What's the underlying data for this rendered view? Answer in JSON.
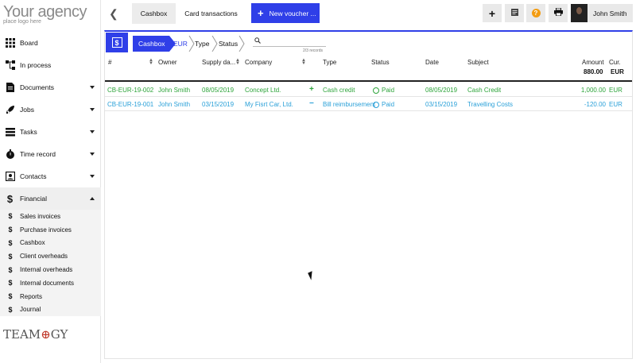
{
  "logo": {
    "title": "Your agency",
    "subtitle": "place logo here"
  },
  "sidebar": {
    "items": [
      {
        "label": "Board",
        "icon": "grid-icon"
      },
      {
        "label": "In process",
        "icon": "process-icon"
      },
      {
        "label": "Documents",
        "icon": "document-icon"
      },
      {
        "label": "Jobs",
        "icon": "rocket-icon"
      },
      {
        "label": "Tasks",
        "icon": "tasks-icon"
      },
      {
        "label": "Time record",
        "icon": "stopwatch-icon"
      },
      {
        "label": "Contacts",
        "icon": "contacts-icon"
      },
      {
        "label": "Financial",
        "icon": "dollar-icon"
      }
    ],
    "financial_sub": [
      {
        "label": "Sales invoices"
      },
      {
        "label": "Purchase invoices"
      },
      {
        "label": "Cashbox"
      },
      {
        "label": "Client overheads"
      },
      {
        "label": "Internal overheads"
      },
      {
        "label": "Internal documents"
      },
      {
        "label": "Reports"
      },
      {
        "label": "Journal"
      }
    ],
    "footer_logo": "TEAMOGY"
  },
  "topbar": {
    "tabs": [
      {
        "label": "Cashbox"
      },
      {
        "label": "Card transactions"
      }
    ],
    "new_button": "New voucher ...",
    "user_name": "John Smith"
  },
  "breadcrumbs": {
    "items": [
      "Cashbox",
      "EUR",
      "Type",
      "Status"
    ],
    "records": "2/3 records"
  },
  "table": {
    "columns": {
      "num": "#",
      "owner": "Owner",
      "supply_date": "Supply da...",
      "company": "Company",
      "type": "Type",
      "status": "Status",
      "date": "Date",
      "subject": "Subject",
      "amount": "Amount",
      "cur": "Cur."
    },
    "totals": {
      "amount": "880.00",
      "cur": "EUR"
    },
    "rows": [
      {
        "num": "CB-EUR-19-002",
        "owner": "John Smith",
        "supply_date": "08/05/2019",
        "company": "Concept Ltd.",
        "sign": "+",
        "type": "Cash credit",
        "status": "Paid",
        "date": "08/05/2019",
        "subject": "Cash Credit",
        "amount": "1,000.00",
        "cur": "EUR"
      },
      {
        "num": "CB-EUR-19-001",
        "owner": "John Smith",
        "supply_date": "03/15/2019",
        "company": "My Fisrt Car, Ltd.",
        "sign": "−",
        "type": "Bill reimbursement",
        "status": "Paid",
        "date": "03/15/2019",
        "subject": "Travelling Costs",
        "amount": "-120.00",
        "cur": "EUR"
      }
    ]
  },
  "colors": {
    "accent": "#2f3fe8",
    "credit": "#2ea43b",
    "debit": "#2aa0d8",
    "help": "#f39c12"
  }
}
